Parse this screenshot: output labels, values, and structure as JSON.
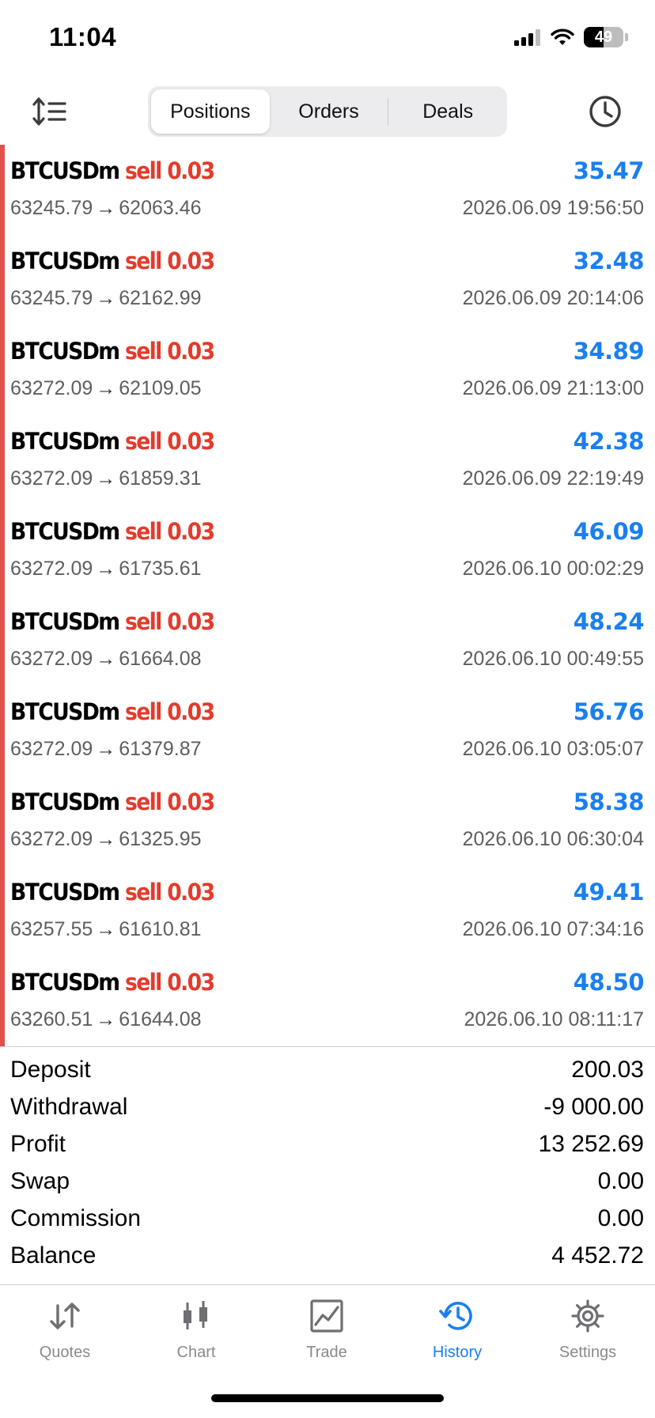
{
  "status_bar": {
    "time": "11:04",
    "battery_percent": "49",
    "icons": [
      "signal-icon",
      "wifi-icon",
      "battery-icon"
    ]
  },
  "toolbar": {
    "sort_icon": "sort-icon",
    "tabs": [
      {
        "label": "Positions",
        "active": true
      },
      {
        "label": "Orders",
        "active": false
      },
      {
        "label": "Deals",
        "active": false
      }
    ],
    "clock_icon": "clock-icon"
  },
  "colors": {
    "sell": "#e33b2c",
    "profit": "#1a7ff0",
    "accent_bar": "#e0534d",
    "active_tab": "#1a7ff0"
  },
  "positions": [
    {
      "symbol": "BTCUSDm",
      "side": "sell",
      "volume": "0.03",
      "profit": "35.47",
      "open_price": "63245.79",
      "close_price": "62063.46",
      "time": "2026.06.09 19:56:50"
    },
    {
      "symbol": "BTCUSDm",
      "side": "sell",
      "volume": "0.03",
      "profit": "32.48",
      "open_price": "63245.79",
      "close_price": "62162.99",
      "time": "2026.06.09 20:14:06"
    },
    {
      "symbol": "BTCUSDm",
      "side": "sell",
      "volume": "0.03",
      "profit": "34.89",
      "open_price": "63272.09",
      "close_price": "62109.05",
      "time": "2026.06.09 21:13:00"
    },
    {
      "symbol": "BTCUSDm",
      "side": "sell",
      "volume": "0.03",
      "profit": "42.38",
      "open_price": "63272.09",
      "close_price": "61859.31",
      "time": "2026.06.09 22:19:49"
    },
    {
      "symbol": "BTCUSDm",
      "side": "sell",
      "volume": "0.03",
      "profit": "46.09",
      "open_price": "63272.09",
      "close_price": "61735.61",
      "time": "2026.06.10 00:02:29"
    },
    {
      "symbol": "BTCUSDm",
      "side": "sell",
      "volume": "0.03",
      "profit": "48.24",
      "open_price": "63272.09",
      "close_price": "61664.08",
      "time": "2026.06.10 00:49:55"
    },
    {
      "symbol": "BTCUSDm",
      "side": "sell",
      "volume": "0.03",
      "profit": "56.76",
      "open_price": "63272.09",
      "close_price": "61379.87",
      "time": "2026.06.10 03:05:07"
    },
    {
      "symbol": "BTCUSDm",
      "side": "sell",
      "volume": "0.03",
      "profit": "58.38",
      "open_price": "63272.09",
      "close_price": "61325.95",
      "time": "2026.06.10 06:30:04"
    },
    {
      "symbol": "BTCUSDm",
      "side": "sell",
      "volume": "0.03",
      "profit": "49.41",
      "open_price": "63257.55",
      "close_price": "61610.81",
      "time": "2026.06.10 07:34:16"
    },
    {
      "symbol": "BTCUSDm",
      "side": "sell",
      "volume": "0.03",
      "profit": "48.50",
      "open_price": "63260.51",
      "close_price": "61644.08",
      "time": "2026.06.10 08:11:17"
    }
  ],
  "arrow": "→",
  "summary": [
    {
      "label": "Deposit",
      "value": "200.03"
    },
    {
      "label": "Withdrawal",
      "value": "-9 000.00"
    },
    {
      "label": "Profit",
      "value": "13 252.69"
    },
    {
      "label": "Swap",
      "value": "0.00"
    },
    {
      "label": "Commission",
      "value": "0.00"
    },
    {
      "label": "Balance",
      "value": "4 452.72"
    }
  ],
  "tabbar": [
    {
      "label": "Quotes",
      "icon": "quotes-arrows-icon",
      "active": false
    },
    {
      "label": "Chart",
      "icon": "candlestick-chart-icon",
      "active": false
    },
    {
      "label": "Trade",
      "icon": "trade-chart-icon",
      "active": false
    },
    {
      "label": "History",
      "icon": "history-clock-icon",
      "active": true
    },
    {
      "label": "Settings",
      "icon": "gear-icon",
      "active": false
    }
  ]
}
